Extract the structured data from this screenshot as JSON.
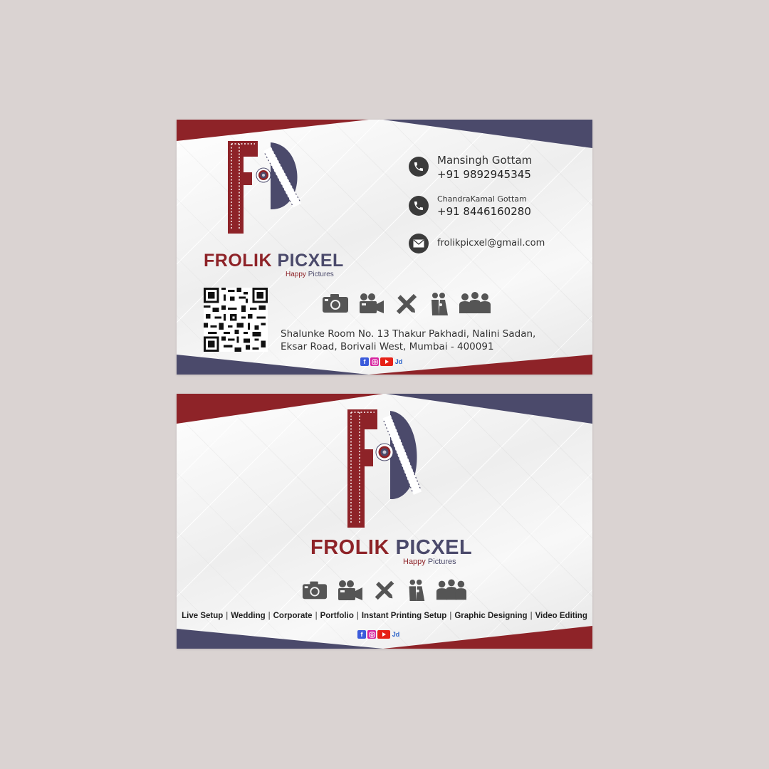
{
  "brand": {
    "name_part1": "FROLIK",
    "name_part2": "PICXEL",
    "tagline_part1": "Happy",
    "tagline_part2": "Pictures",
    "colors": {
      "red": "#8e2328",
      "navy": "#4b4a6b",
      "background": "#dad3d2"
    }
  },
  "front": {
    "contacts": [
      {
        "icon": "phone-icon",
        "name": "Mansingh Gottam",
        "phone": "+91 9892945345"
      },
      {
        "icon": "phone-icon",
        "name": "ChandraKamal Gottam",
        "phone": "+91 8446160280"
      }
    ],
    "email": {
      "icon": "mail-icon",
      "value": "frolikpicxel@gmail.com"
    },
    "address_line1": "Shalunke Room No. 13 Thakur Pakhadi, Nalini Sadan,",
    "address_line2": "Eksar Road, Borivali West, Mumbai - 400091",
    "service_icons": [
      "camera-icon",
      "video-camera-icon",
      "design-tools-icon",
      "wedding-couple-icon",
      "corporate-group-icon"
    ],
    "social_icons": [
      "facebook-icon",
      "instagram-icon",
      "youtube-icon",
      "justdial-icon"
    ]
  },
  "back": {
    "services": [
      "Live Setup",
      "Wedding",
      "Corporate",
      "Portfolio",
      "Instant Printing Setup",
      "Graphic Designing",
      "Video Editing"
    ],
    "separator": "|",
    "social_labels": {
      "facebook": "f",
      "justdial": "Jd"
    }
  }
}
